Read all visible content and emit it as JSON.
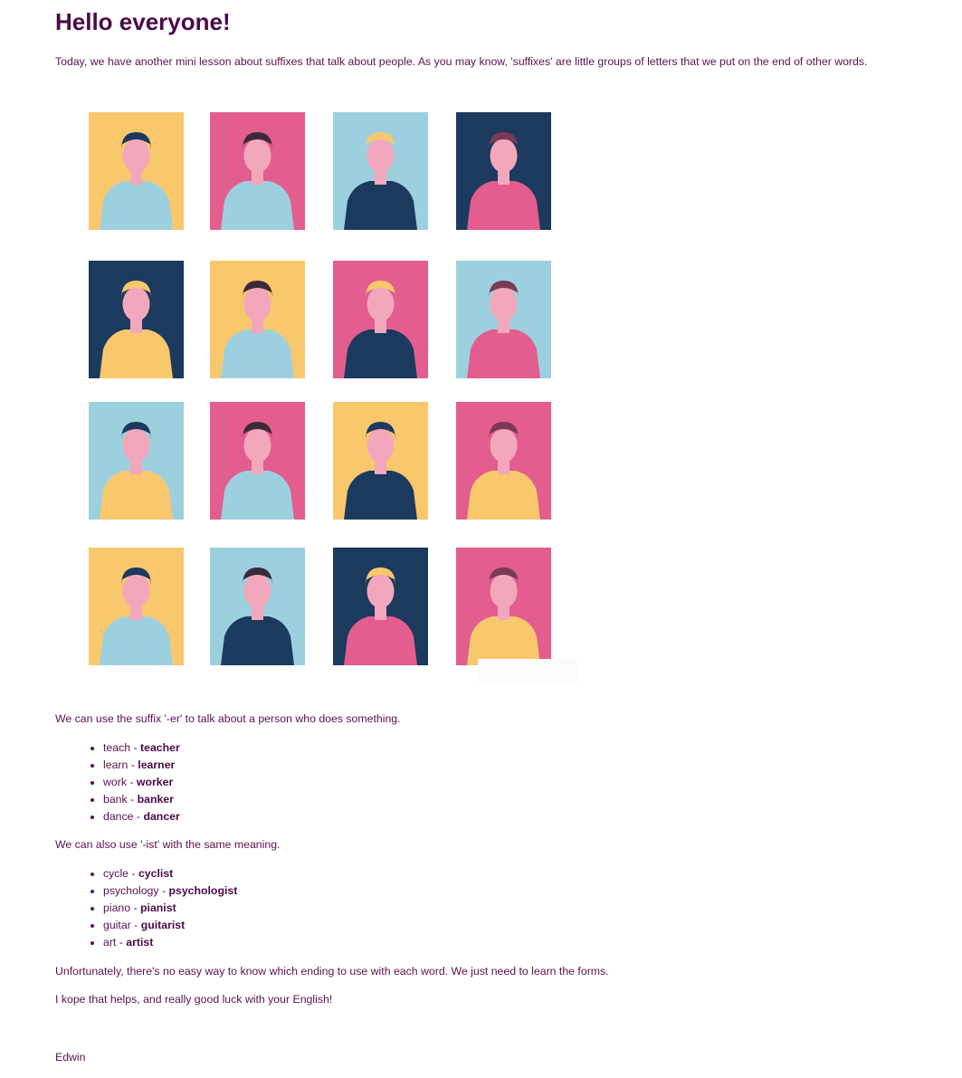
{
  "heading": "Hello everyone!",
  "intro": "Today, we have another mini lesson about suffixes that talk about people. As you may know, 'suffixes' are little groups of letters that we put on the end of other words.",
  "colors": {
    "text": "#5a1052",
    "heading": "#4a0a47",
    "yellow": "#f9c86c",
    "pink": "#e35d8e",
    "blue": "#9dd0df",
    "navy": "#1b3a5e",
    "skin": "#f3a7bd"
  },
  "illustration": {
    "tiles": [
      {
        "bg": "yellow",
        "icon": "cap-person-icon"
      },
      {
        "bg": "pink",
        "icon": "builder-icon"
      },
      {
        "bg": "blue",
        "icon": "doctor-icon"
      },
      {
        "bg": "navy",
        "icon": "blonde-woman-icon"
      },
      {
        "bg": "navy",
        "icon": "guitarist-icon"
      },
      {
        "bg": "yellow",
        "icon": "police-officer-icon"
      },
      {
        "bg": "pink",
        "icon": "long-hair-woman-icon"
      },
      {
        "bg": "blue",
        "icon": "painter-icon"
      },
      {
        "bg": "blue",
        "icon": "firefighter-icon"
      },
      {
        "bg": "pink",
        "icon": "chef-icon"
      },
      {
        "bg": "yellow",
        "icon": "engineer-phone-icon"
      },
      {
        "bg": "pink",
        "icon": "pilot-icon"
      },
      {
        "bg": "yellow",
        "icon": "welder-icon"
      },
      {
        "bg": "blue",
        "icon": "tourist-icon"
      },
      {
        "bg": "navy",
        "icon": "glasses-man-icon"
      },
      {
        "bg": "pink",
        "icon": "dark-person-icon"
      }
    ]
  },
  "er": {
    "intro": "We can use the suffix '-er' to talk about a person who does something.",
    "items": [
      {
        "base": "teach",
        "sep": " - ",
        "derived": "teacher"
      },
      {
        "base": "learn",
        "sep": " - ",
        "derived": "learner"
      },
      {
        "base": "work",
        "sep": " - ",
        "derived": "worker"
      },
      {
        "base": "bank",
        "sep": " - ",
        "derived": "banker"
      },
      {
        "base": "dance",
        "sep": " - ",
        "derived": "dancer"
      }
    ]
  },
  "ist": {
    "intro": "We can also use '-ist' with the same meaning.",
    "items": [
      {
        "base": "cycle",
        "sep": " - ",
        "derived": "cyclist"
      },
      {
        "base": "psychology",
        "sep": " - ",
        "derived": "psychologist"
      },
      {
        "base": "piano",
        "sep": " - ",
        "derived": "pianist"
      },
      {
        "base": "guitar",
        "sep": " - ",
        "derived": "guitarist"
      },
      {
        "base": "art",
        "sep": " - ",
        "derived": "artist"
      }
    ]
  },
  "closing": "Unfortunately, there's no easy way to know which ending to use with each word. We just need to learn the forms.",
  "wish": "I kope that helps, and really good luck with your English!",
  "signature": "Edwin"
}
